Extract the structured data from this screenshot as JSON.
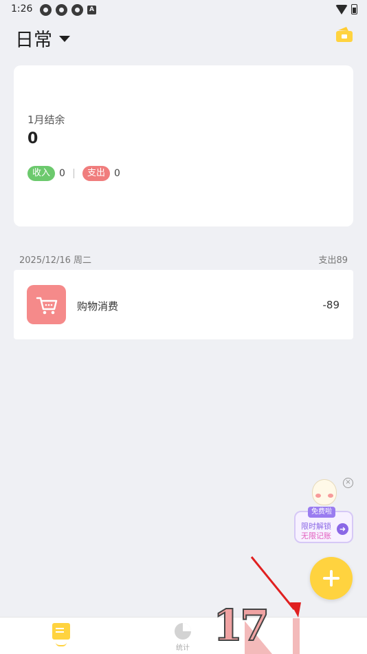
{
  "status_bar": {
    "time": "1:26",
    "notif_a": "A"
  },
  "header": {
    "book_name": "日常"
  },
  "summary": {
    "month_label": "1月结余",
    "balance": "0",
    "income_label": "收入",
    "income_value": "0",
    "expense_label": "支出",
    "expense_value": "0"
  },
  "day": {
    "date": "2025/12/16 周二",
    "total": "支出89",
    "transactions": [
      {
        "category": "购物消费",
        "amount": "-89",
        "icon": "shopping-cart-icon",
        "color": "#f58a8a"
      }
    ]
  },
  "promo": {
    "badge": "免费啦",
    "line1": "限时解锁",
    "line2": "无限记账"
  },
  "bottom_nav": {
    "stats_label": "统计"
  },
  "overlay": {
    "step_number": "17"
  },
  "colors": {
    "accent": "#ffd33f",
    "income": "#6cc96d",
    "expense": "#f07d7d",
    "background": "#eff0f4"
  }
}
